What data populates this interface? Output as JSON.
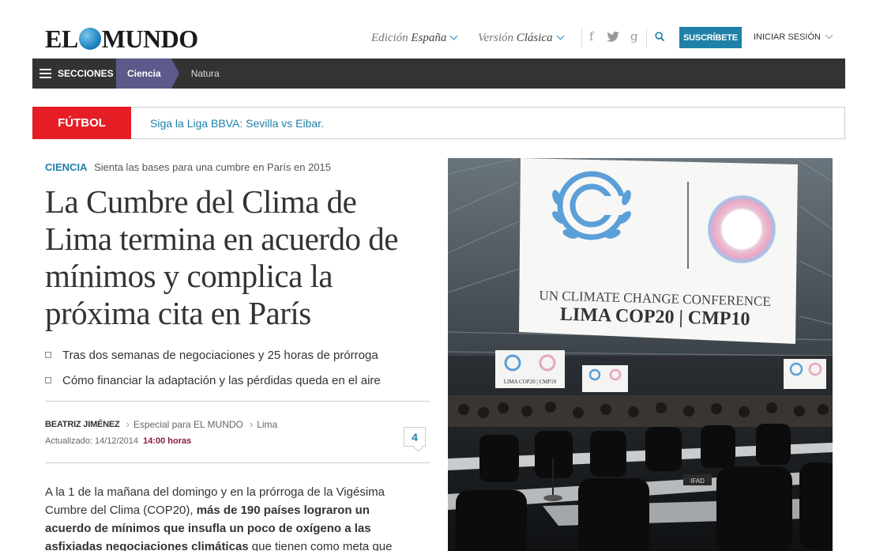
{
  "header": {
    "logo_left": "EL",
    "logo_right": "MUNDO",
    "edition_label": "Edición",
    "edition_value": "España",
    "version_label": "Versión",
    "version_value": "Clásica",
    "social": [
      "f",
      "t",
      "g"
    ],
    "subscribe_label": "SUSCRÍBETE",
    "login_label": "INICIAR SESIÓN"
  },
  "nav": {
    "sections_label": "SECCIONES",
    "breadcrumb_current": "Ciencia",
    "breadcrumb_next": "Natura"
  },
  "ticker": {
    "tag": "FÚTBOL",
    "text": "Siga la Liga BBVA: Sevilla vs Eibar."
  },
  "article": {
    "section": "CIENCIA",
    "kicker": "Sienta las bases para una cumbre en París en 2015",
    "headline": "La Cumbre del Clima de Lima termina en acuerdo de mínimos y complica la próxima cita en París",
    "bullets": [
      "Tras dos semanas de negociaciones y 25 horas de prórroga",
      "Cómo financiar la adaptación y las pérdidas queda en el aire"
    ],
    "author": "BEATRIZ JIMÉNEZ",
    "byline_role": "Especial para EL MUNDO",
    "byline_place": "Lima",
    "updated_label": "Actualizado: 14/12/2014",
    "updated_time": "14:00 horas",
    "comment_count": "4",
    "body_part1": "A la 1 de la mañana del domingo y en la prórroga de la Vigésima Cumbre del Clima (COP20), ",
    "body_bold": "más de 190 países lograron un acuerdo de mínimos que insufla un poco de oxígeno a las asfixiadas negociaciones climáticas",
    "body_part2": " que tienen como meta que"
  },
  "photo": {
    "screen_line1": "UN CLIMATE CHANGE CONFERENCE",
    "screen_line2": "LIMA COP20 | CMP10",
    "small_screen_text": "LIMA COP20 | CMP10",
    "desk_sign": "IFAD"
  },
  "colors": {
    "brand_blue": "#1f80a8",
    "nav_dark": "#333333",
    "nav_active": "#5b5a8a",
    "ticker_red": "#e51d24",
    "time_accent": "#8b1a3a"
  }
}
